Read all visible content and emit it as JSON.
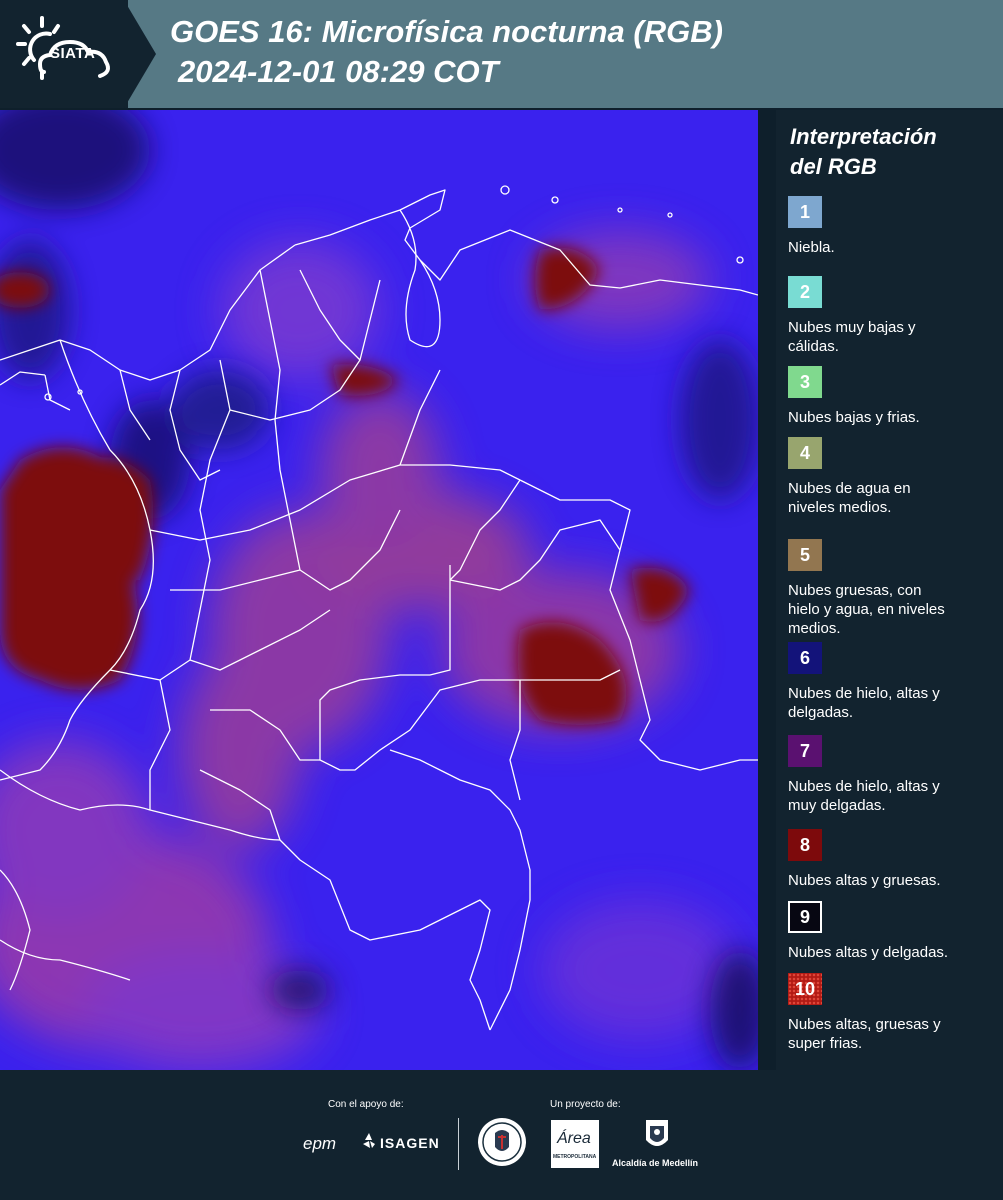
{
  "header": {
    "logo_text": "SIATA",
    "title_line1": "GOES 16: Microfísica nocturna (RGB)",
    "title_line2": "2024-12-01 08:29 COT"
  },
  "legend": {
    "title_line1": "Interpretación",
    "title_line2": "del RGB",
    "items": [
      {
        "number": "1",
        "label_lines": [
          "Niebla."
        ],
        "color": "#7ea7cf"
      },
      {
        "number": "2",
        "label_lines": [
          "Nubes muy bajas y",
          "cálidas."
        ],
        "color": "#79dcd3"
      },
      {
        "number": "3",
        "label_lines": [
          "Nubes bajas y frias."
        ],
        "color": "#80d98e"
      },
      {
        "number": "4",
        "label_lines": [
          "Nubes de agua en",
          "niveles medios."
        ],
        "color": "#98a56e"
      },
      {
        "number": "5",
        "label_lines": [
          "Nubes gruesas, con",
          "hielo y agua, en niveles",
          "medios."
        ],
        "color": "#927650"
      },
      {
        "number": "6",
        "label_lines": [
          "Nubes de hielo, altas y",
          "delgadas."
        ],
        "color": "#13137a"
      },
      {
        "number": "7",
        "label_lines": [
          "Nubes de hielo, altas y",
          "muy delgadas."
        ],
        "color": "#5a1170"
      },
      {
        "number": "8",
        "label_lines": [
          "Nubes altas y gruesas."
        ],
        "color": "#7d0a0c"
      },
      {
        "number": "9",
        "label_lines": [
          "Nubes altas y delgadas."
        ],
        "color": "#070712"
      },
      {
        "number": "10",
        "label_lines": [
          "Nubes altas, gruesas y",
          "super frias."
        ],
        "color": "#b21a14"
      }
    ]
  },
  "footer": {
    "support_caption": "Con el apoyo de:",
    "project_caption": "Un proyecto de:",
    "partner_epm": "epm",
    "partner_isagen": "ISAGEN",
    "partner_area": "Área",
    "partner_area_sub": "METROPOLITANA",
    "partner_alcaldia": "Alcaldía de Medellín"
  },
  "colors": {
    "header_band": "#567985",
    "background": "#12232f",
    "map_base": "#3b22f0",
    "map_thick_cloud": "#7d0a0c",
    "map_thin_cloud": "#9a3aa8",
    "borders": "#ffffff"
  }
}
